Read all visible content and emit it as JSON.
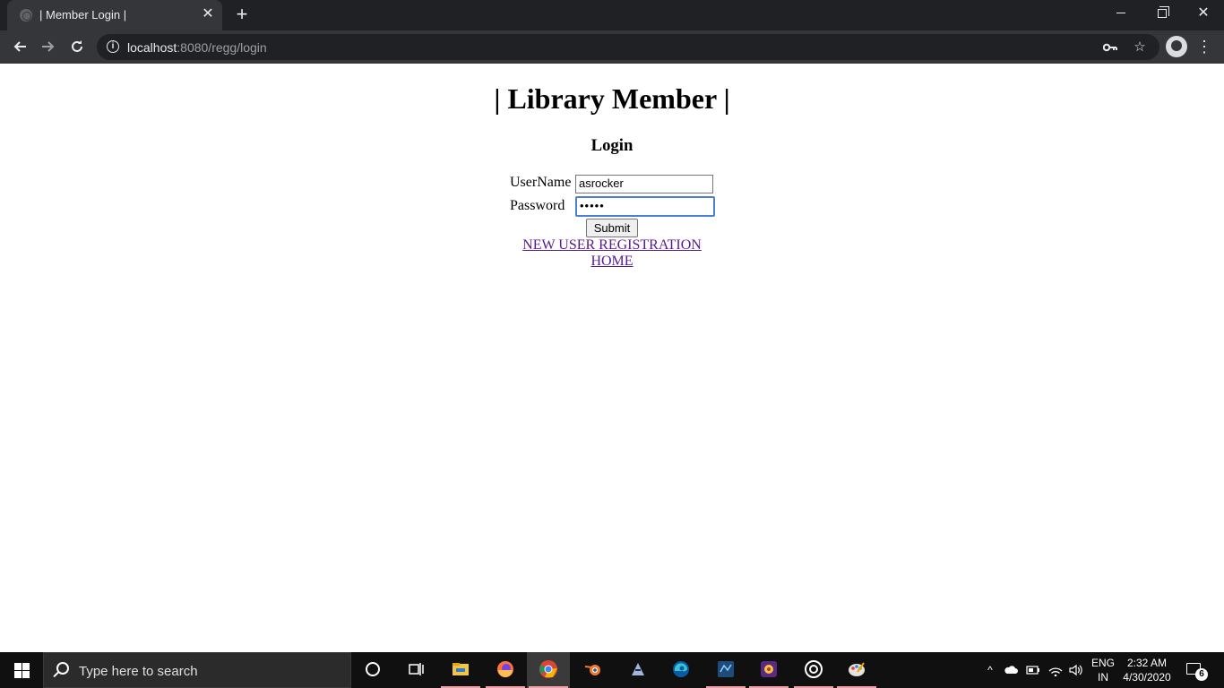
{
  "browser": {
    "tab_title": "| Member Login |",
    "tab_close": "✕",
    "new_tab": "+",
    "url_host": "localhost",
    "url_rest": ":8080/regg/login",
    "icons": [
      "info-icon",
      "key-icon",
      "star-icon",
      "profile-avatar",
      "menu-dots-icon"
    ]
  },
  "page": {
    "heading": "| Library Member |",
    "subheading": "Login",
    "username_label": "UserName",
    "username_value": "asrocker",
    "password_label": "Password",
    "password_value": "•••••",
    "submit_label": "Submit",
    "register_link": "NEW USER REGISTRATION",
    "home_link": "HOME",
    "link_color": "#551a8b",
    "focus_color": "#4a7fd4"
  },
  "taskbar": {
    "search_placeholder": "Type here to search",
    "apps": [
      "cortana",
      "task-view",
      "file-explorer",
      "firefox",
      "chrome",
      "blender",
      "eclipse",
      "edge",
      "mysql-workbench",
      "game",
      "obs",
      "paint"
    ],
    "active_app": "chrome",
    "language_top": "ENG",
    "language_bottom": "IN",
    "time": "2:32 AM",
    "date": "4/30/2020",
    "notification_count": "6"
  }
}
